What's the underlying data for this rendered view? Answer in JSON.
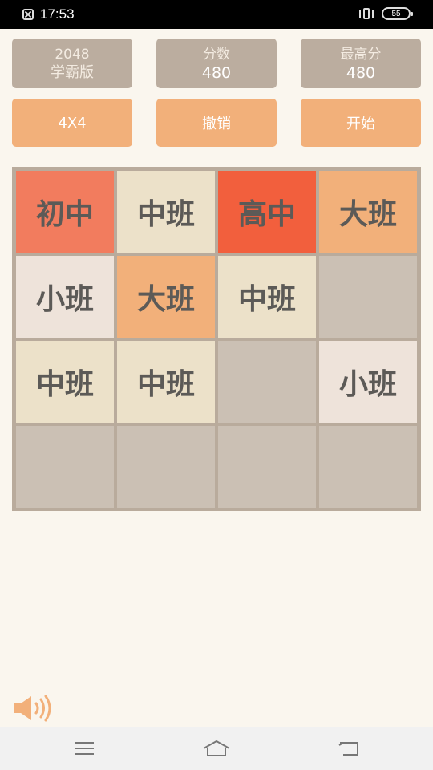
{
  "status_bar": {
    "time": "17:53",
    "battery": "55"
  },
  "header": {
    "brand_line1": "2048",
    "brand_line2": "学霸版",
    "score_label": "分数",
    "score_value": "480",
    "best_label": "最高分",
    "best_value": "480"
  },
  "buttons": {
    "size": "4X4",
    "undo": "撤销",
    "start": "开始"
  },
  "board": {
    "rows": [
      [
        "初中",
        "中班",
        "高中",
        "大班"
      ],
      [
        "小班",
        "大班",
        "中班",
        ""
      ],
      [
        "中班",
        "中班",
        "",
        "小班"
      ],
      [
        "",
        "",
        "",
        ""
      ]
    ]
  },
  "colors": {
    "background": "#faf6ee",
    "board": "#b9ab9c",
    "empty_cell": "#cbc0b4",
    "button": "#f2b07a",
    "info_box": "#bbad9f"
  },
  "icons": {
    "sound": "speaker-icon",
    "nav_menu": "menu-icon",
    "nav_home": "home-icon",
    "nav_back": "back-icon"
  }
}
